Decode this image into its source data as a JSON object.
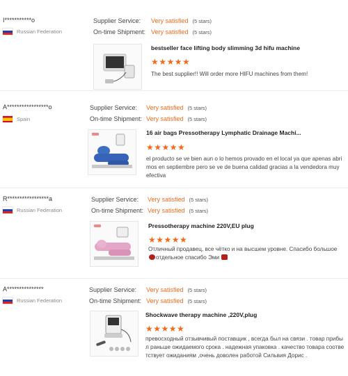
{
  "labels": {
    "supplier_service": "Supplier Service:",
    "ontime_shipment": "On-time Shipment:"
  },
  "reviews": [
    {
      "buyer": "I***********o",
      "country": "Russian Federation",
      "flag": "ru",
      "supplier_service": "Very satisfied",
      "supplier_stars": "(5 stars)",
      "ontime_shipment": "Very satisfied",
      "ontime_stars": "(5 stars)",
      "product": "bestseller face lifting body slimming 3d hifu machine",
      "rating": "★★★★★",
      "comment": "The best supplier!! Will order more HIFU machines from them!"
    },
    {
      "buyer": "A*****************o",
      "country": "Spain",
      "flag": "es",
      "supplier_service": "Very satisfied",
      "supplier_stars": "(5 stars)",
      "ontime_shipment": "Very satisfied",
      "ontime_stars": "(5 stars)",
      "product": "16 air bags Pressotherapy Lymphatic Drainage Machi...",
      "rating": "★★★★★",
      "comment": "el producto se ve bien aun  o lo hemos provado  en el local  ya que  apenas abrimos en  septiembre  pero  se ve de buena calidad  gracias a la vendedora muy efectiva"
    },
    {
      "buyer": "R*****************a",
      "country": "Russian Federation",
      "flag": "ru",
      "supplier_service": "Very satisfied",
      "supplier_stars": "(5 stars)",
      "ontime_shipment": "Very satisfied",
      "ontime_stars": "(5 stars)",
      "product": "Pressotherapy machine 220V,EU plug",
      "rating": "★★★★★",
      "comment_a": "Отличный продавец, все чётко и на высшем уровне. Спасибо большое",
      "comment_b": "отдельное спасибо Эми"
    },
    {
      "buyer": "A***************",
      "country": "Russian Federation",
      "flag": "ru",
      "supplier_service": "Very satisfied",
      "supplier_stars": "(5 stars)",
      "ontime_shipment": "Very satisfied",
      "ontime_stars": "(5 stars)",
      "product": "Shockwave therapy machine ,220V,plug",
      "rating": "★★★★★",
      "comment": "превосходный отзывчивый поставщик , всегда был на связи . товар прибыл раньше ожидаемого срока . надежная упаковка . качество товара соответствует ожиданиям ,очень доволен работой Сильвия Дорис ."
    }
  ]
}
